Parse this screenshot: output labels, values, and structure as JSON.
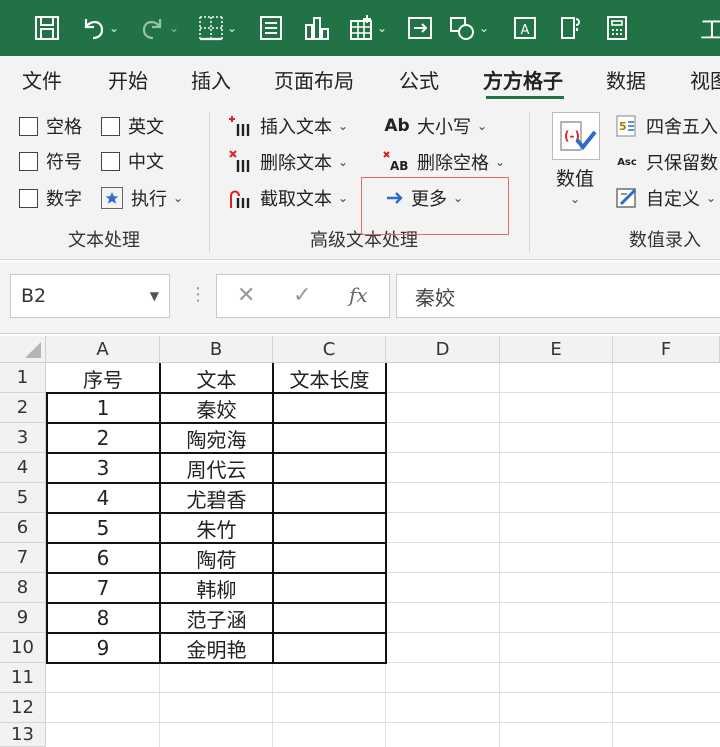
{
  "qat": {
    "title_fragment": "工",
    "buttons": [
      "save-icon",
      "undo-icon",
      "redo-icon",
      "borders-icon",
      "form-icon",
      "chart-icon",
      "insert-table-icon",
      "screen-icon",
      "shapes-icon",
      "text-box-icon",
      "format-icon",
      "calculator-icon"
    ]
  },
  "tabs": [
    "文件",
    "开始",
    "插入",
    "页面布局",
    "公式",
    "方方格子",
    "数据",
    "视图"
  ],
  "active_tab": "方方格子",
  "ribbon": {
    "text_group": {
      "label": "文本处理",
      "checkboxes": [
        "空格",
        "英文",
        "符号",
        "中文",
        "数字"
      ],
      "execute": "执行"
    },
    "advanced_group": {
      "label": "高级文本处理",
      "insert_text": "插入文本",
      "delete_text": "删除文本",
      "extract_text": "截取文本",
      "case": "大小写",
      "delete_spaces": "删除空格",
      "more": "更多"
    },
    "value_group": {
      "label": "数值录入",
      "value": "数值",
      "round": "四舍五入",
      "keep_value": "只保留数",
      "custom": "自定义"
    }
  },
  "formula_bar": {
    "name_box": "B2",
    "formula": "秦姣",
    "cancel_symbol": "✕",
    "enter_symbol": "✓",
    "fx_symbol": "fx"
  },
  "sheet": {
    "columns": [
      "A",
      "B",
      "C",
      "D",
      "E",
      "F"
    ],
    "rows": [
      "1",
      "2",
      "3",
      "4",
      "5",
      "6",
      "7",
      "8",
      "9",
      "10",
      "11",
      "12",
      "13"
    ],
    "headers": [
      "序号",
      "文本",
      "文本长度"
    ],
    "data": [
      [
        "1",
        "秦姣",
        ""
      ],
      [
        "2",
        "陶宛海",
        ""
      ],
      [
        "3",
        "周代云",
        ""
      ],
      [
        "4",
        "尤碧香",
        ""
      ],
      [
        "5",
        "朱竹",
        ""
      ],
      [
        "6",
        "陶荷",
        ""
      ],
      [
        "7",
        "韩柳",
        ""
      ],
      [
        "8",
        "范子涵",
        ""
      ],
      [
        "9",
        "金明艳",
        ""
      ]
    ]
  },
  "colors": {
    "accent": "#217346",
    "highlight": "#e06c6c"
  }
}
